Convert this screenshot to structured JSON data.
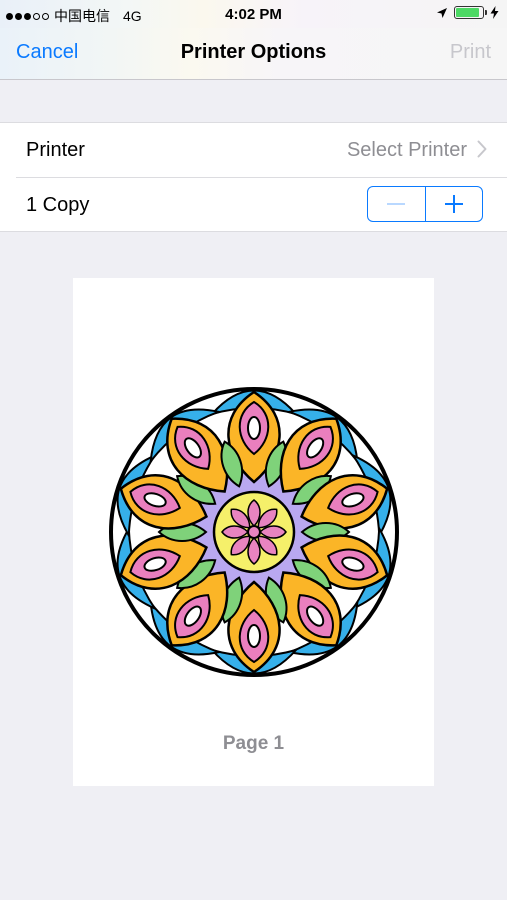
{
  "status_bar": {
    "carrier": "中国电信",
    "network": "4G",
    "time": "4:02 PM",
    "signal_bars_filled": 3,
    "signal_bars_total": 5,
    "battery_level": 0.9
  },
  "nav": {
    "cancel_label": "Cancel",
    "title": "Printer Options",
    "print_label": "Print"
  },
  "options": {
    "printer_label": "Printer",
    "printer_value": "Select Printer",
    "copies_label": "1 Copy"
  },
  "preview": {
    "page_label": "Page 1"
  },
  "colors": {
    "accent": "#0a7aff",
    "disabled": "#c7c7cc",
    "secondary_text": "#8e8e93",
    "background": "#efeff4"
  }
}
